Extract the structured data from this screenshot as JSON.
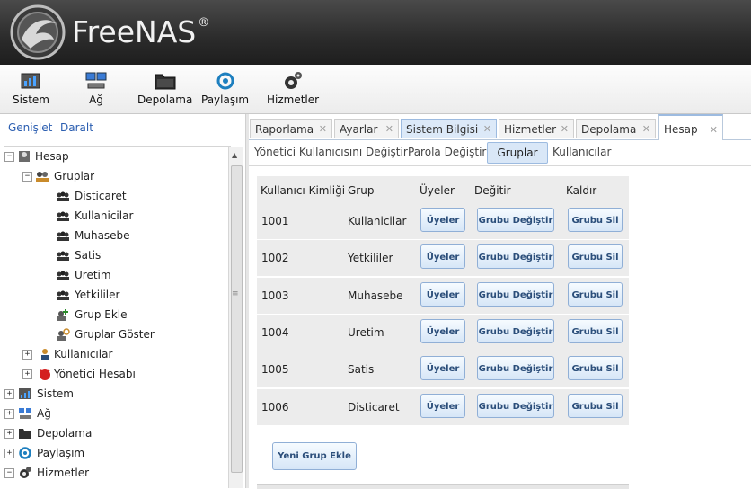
{
  "app": {
    "name": "FreeNAS",
    "trademark": "®"
  },
  "toolbar": {
    "items": [
      {
        "label": "Sistem",
        "icon": "system-icon"
      },
      {
        "label": "Ağ",
        "icon": "network-icon"
      },
      {
        "label": "Depolama",
        "icon": "storage-icon"
      },
      {
        "label": "Paylaşım",
        "icon": "sharing-icon"
      },
      {
        "label": "Hizmetler",
        "icon": "services-icon"
      }
    ]
  },
  "left_panel": {
    "expand_label": "Genişlet",
    "collapse_label": "Daralt",
    "tree": [
      {
        "label": "Hesap",
        "icon": "account-icon",
        "expander": "−"
      },
      {
        "label": "Gruplar",
        "icon": "groups-icon",
        "expander": "−"
      },
      {
        "label": "Disticaret",
        "icon": "group-icon"
      },
      {
        "label": "Kullanicilar",
        "icon": "group-icon"
      },
      {
        "label": "Muhasebe",
        "icon": "group-icon"
      },
      {
        "label": "Satis",
        "icon": "group-icon"
      },
      {
        "label": "Uretim",
        "icon": "group-icon"
      },
      {
        "label": "Yetkililer",
        "icon": "group-icon"
      },
      {
        "label": "Grup Ekle",
        "icon": "add-group-icon"
      },
      {
        "label": "Gruplar Göster",
        "icon": "view-groups-icon"
      },
      {
        "label": "Kullanıcılar",
        "icon": "user-icon",
        "expander": "+"
      },
      {
        "label": "Yönetici Hesabı",
        "icon": "admin-icon",
        "expander": "+"
      },
      {
        "label": "Sistem",
        "icon": "system-icon",
        "expander": "+"
      },
      {
        "label": "Ağ",
        "icon": "network-icon",
        "expander": "+"
      },
      {
        "label": "Depolama",
        "icon": "storage-icon",
        "expander": "+"
      },
      {
        "label": "Paylaşım",
        "icon": "sharing-icon",
        "expander": "+"
      },
      {
        "label": "Hizmetler",
        "icon": "services-icon",
        "expander": "−"
      }
    ]
  },
  "tabs": [
    {
      "label": "Raporlama",
      "close": "✕"
    },
    {
      "label": "Ayarlar",
      "close": "✕"
    },
    {
      "label": "Sistem Bilgisi",
      "close": "✕"
    },
    {
      "label": "Hizmetler",
      "close": "✕"
    },
    {
      "label": "Depolama",
      "close": "✕"
    },
    {
      "label": "Hesap",
      "close": "✕"
    }
  ],
  "subnav": {
    "change_admin_user": "Yönetici Kullanıcısını Değiştir",
    "change_password": "Parola Değiştir",
    "groups": "Gruplar",
    "users": "Kullanıcılar"
  },
  "table": {
    "headers": [
      "Kullanıcı Kimliği",
      "Grup",
      "Üyeler",
      "Değitir",
      "Kaldır"
    ],
    "rows": [
      {
        "id": "1001",
        "group": "Kullanicilar"
      },
      {
        "id": "1002",
        "group": "Yetkililer"
      },
      {
        "id": "1003",
        "group": "Muhasebe"
      },
      {
        "id": "1004",
        "group": "Uretim"
      },
      {
        "id": "1005",
        "group": "Satis"
      },
      {
        "id": "1006",
        "group": "Disticaret"
      }
    ],
    "members_button": "Üyeler",
    "edit_button": "Grubu Değiştir",
    "delete_button": "Grubu Sil"
  },
  "new_group_button": "Yeni Grup Ekle",
  "colors": {
    "header_bg": "#2b2b2b",
    "link": "#2a5db0",
    "accent": "#9dbbe0",
    "row_bg": "#ececec"
  }
}
